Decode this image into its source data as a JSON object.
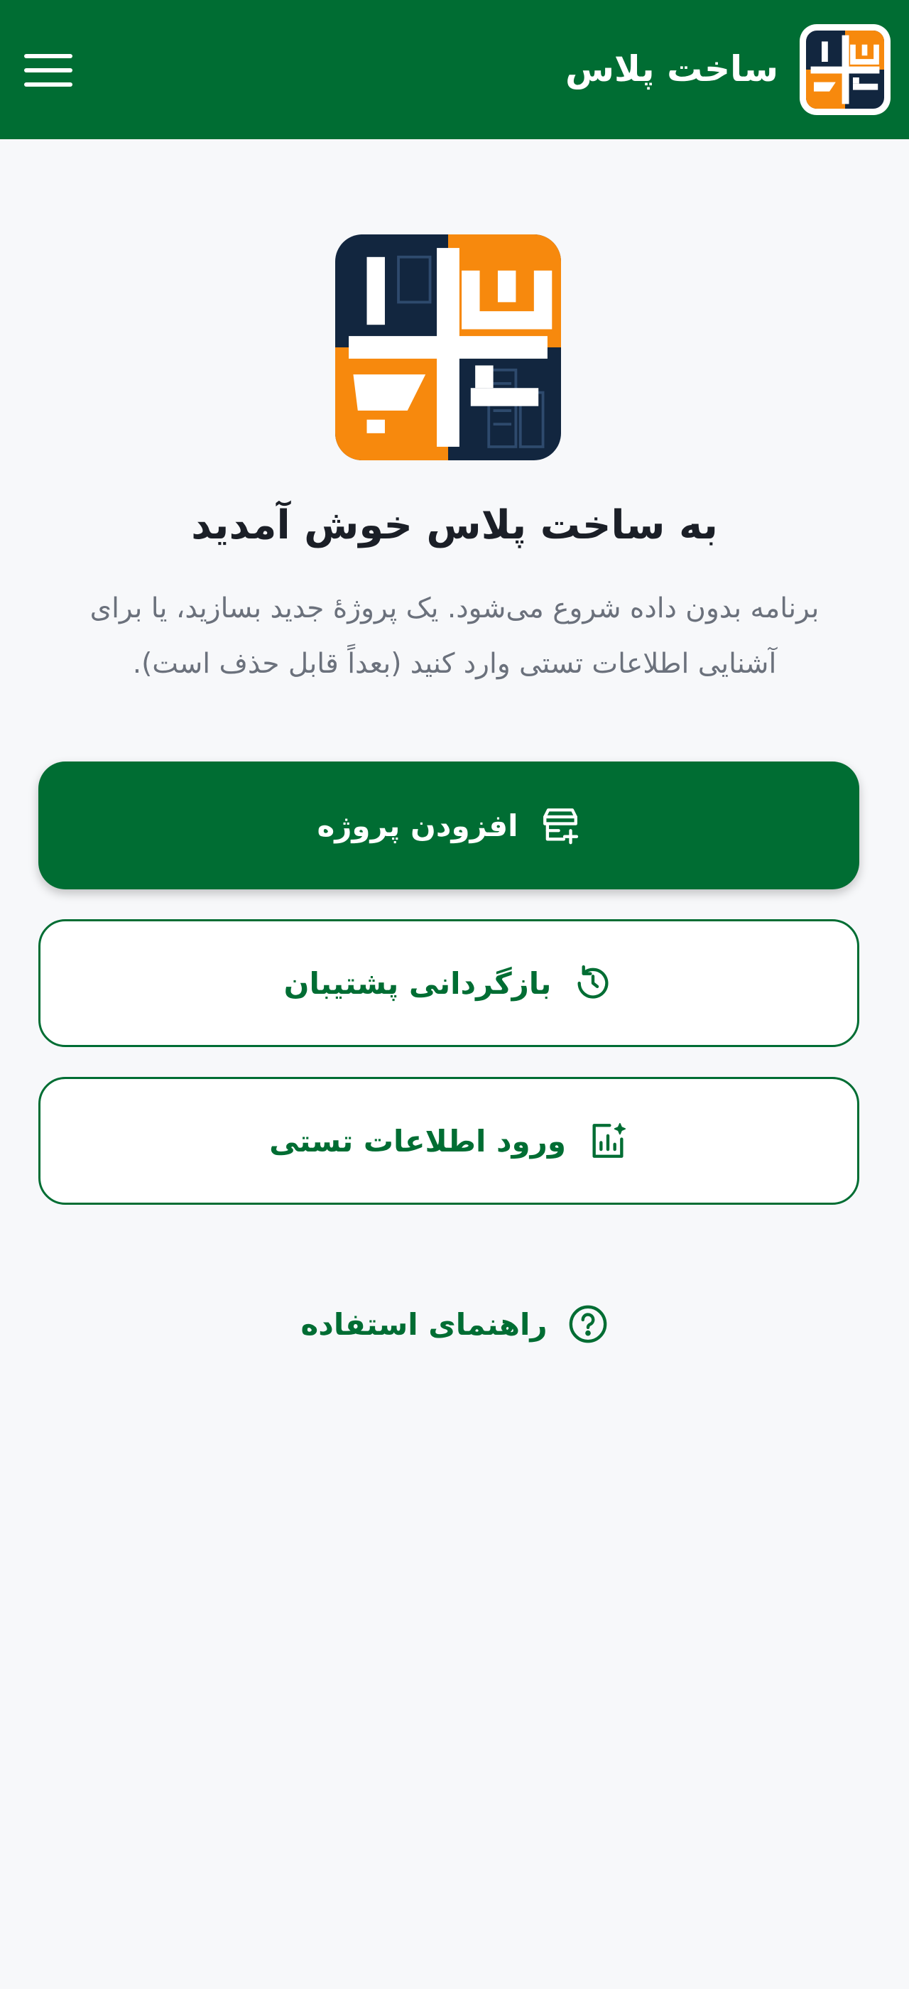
{
  "app": {
    "title": "ساخت پلاس",
    "logo_icon": "sakht-plus-logo-icon"
  },
  "colors": {
    "primary": "#006d33",
    "logo_navy": "#12263f",
    "logo_orange": "#f7890d",
    "background": "#f7f8fa",
    "text_dark": "#1b1f27",
    "text_muted": "#6b717c"
  },
  "header": {
    "menu_icon": "hamburger-menu-icon"
  },
  "welcome": {
    "title": "به ساخت پلاس خوش آمدید",
    "description": "برنامه بدون داده شروع می‌شود. یک پروژهٔ جدید بسازید، یا برای آشنایی اطلاعات تستی وارد کنید (بعداً قابل حذف است)."
  },
  "actions": {
    "add_project": {
      "label": "افزودن پروژه",
      "icon": "add-project-icon"
    },
    "restore_backup": {
      "label": "بازگردانی پشتیبان",
      "icon": "restore-icon"
    },
    "load_sample": {
      "label": "ورود اطلاعات تستی",
      "icon": "sample-data-icon"
    }
  },
  "help": {
    "label": "راهنمای استفاده",
    "icon": "help-icon"
  }
}
